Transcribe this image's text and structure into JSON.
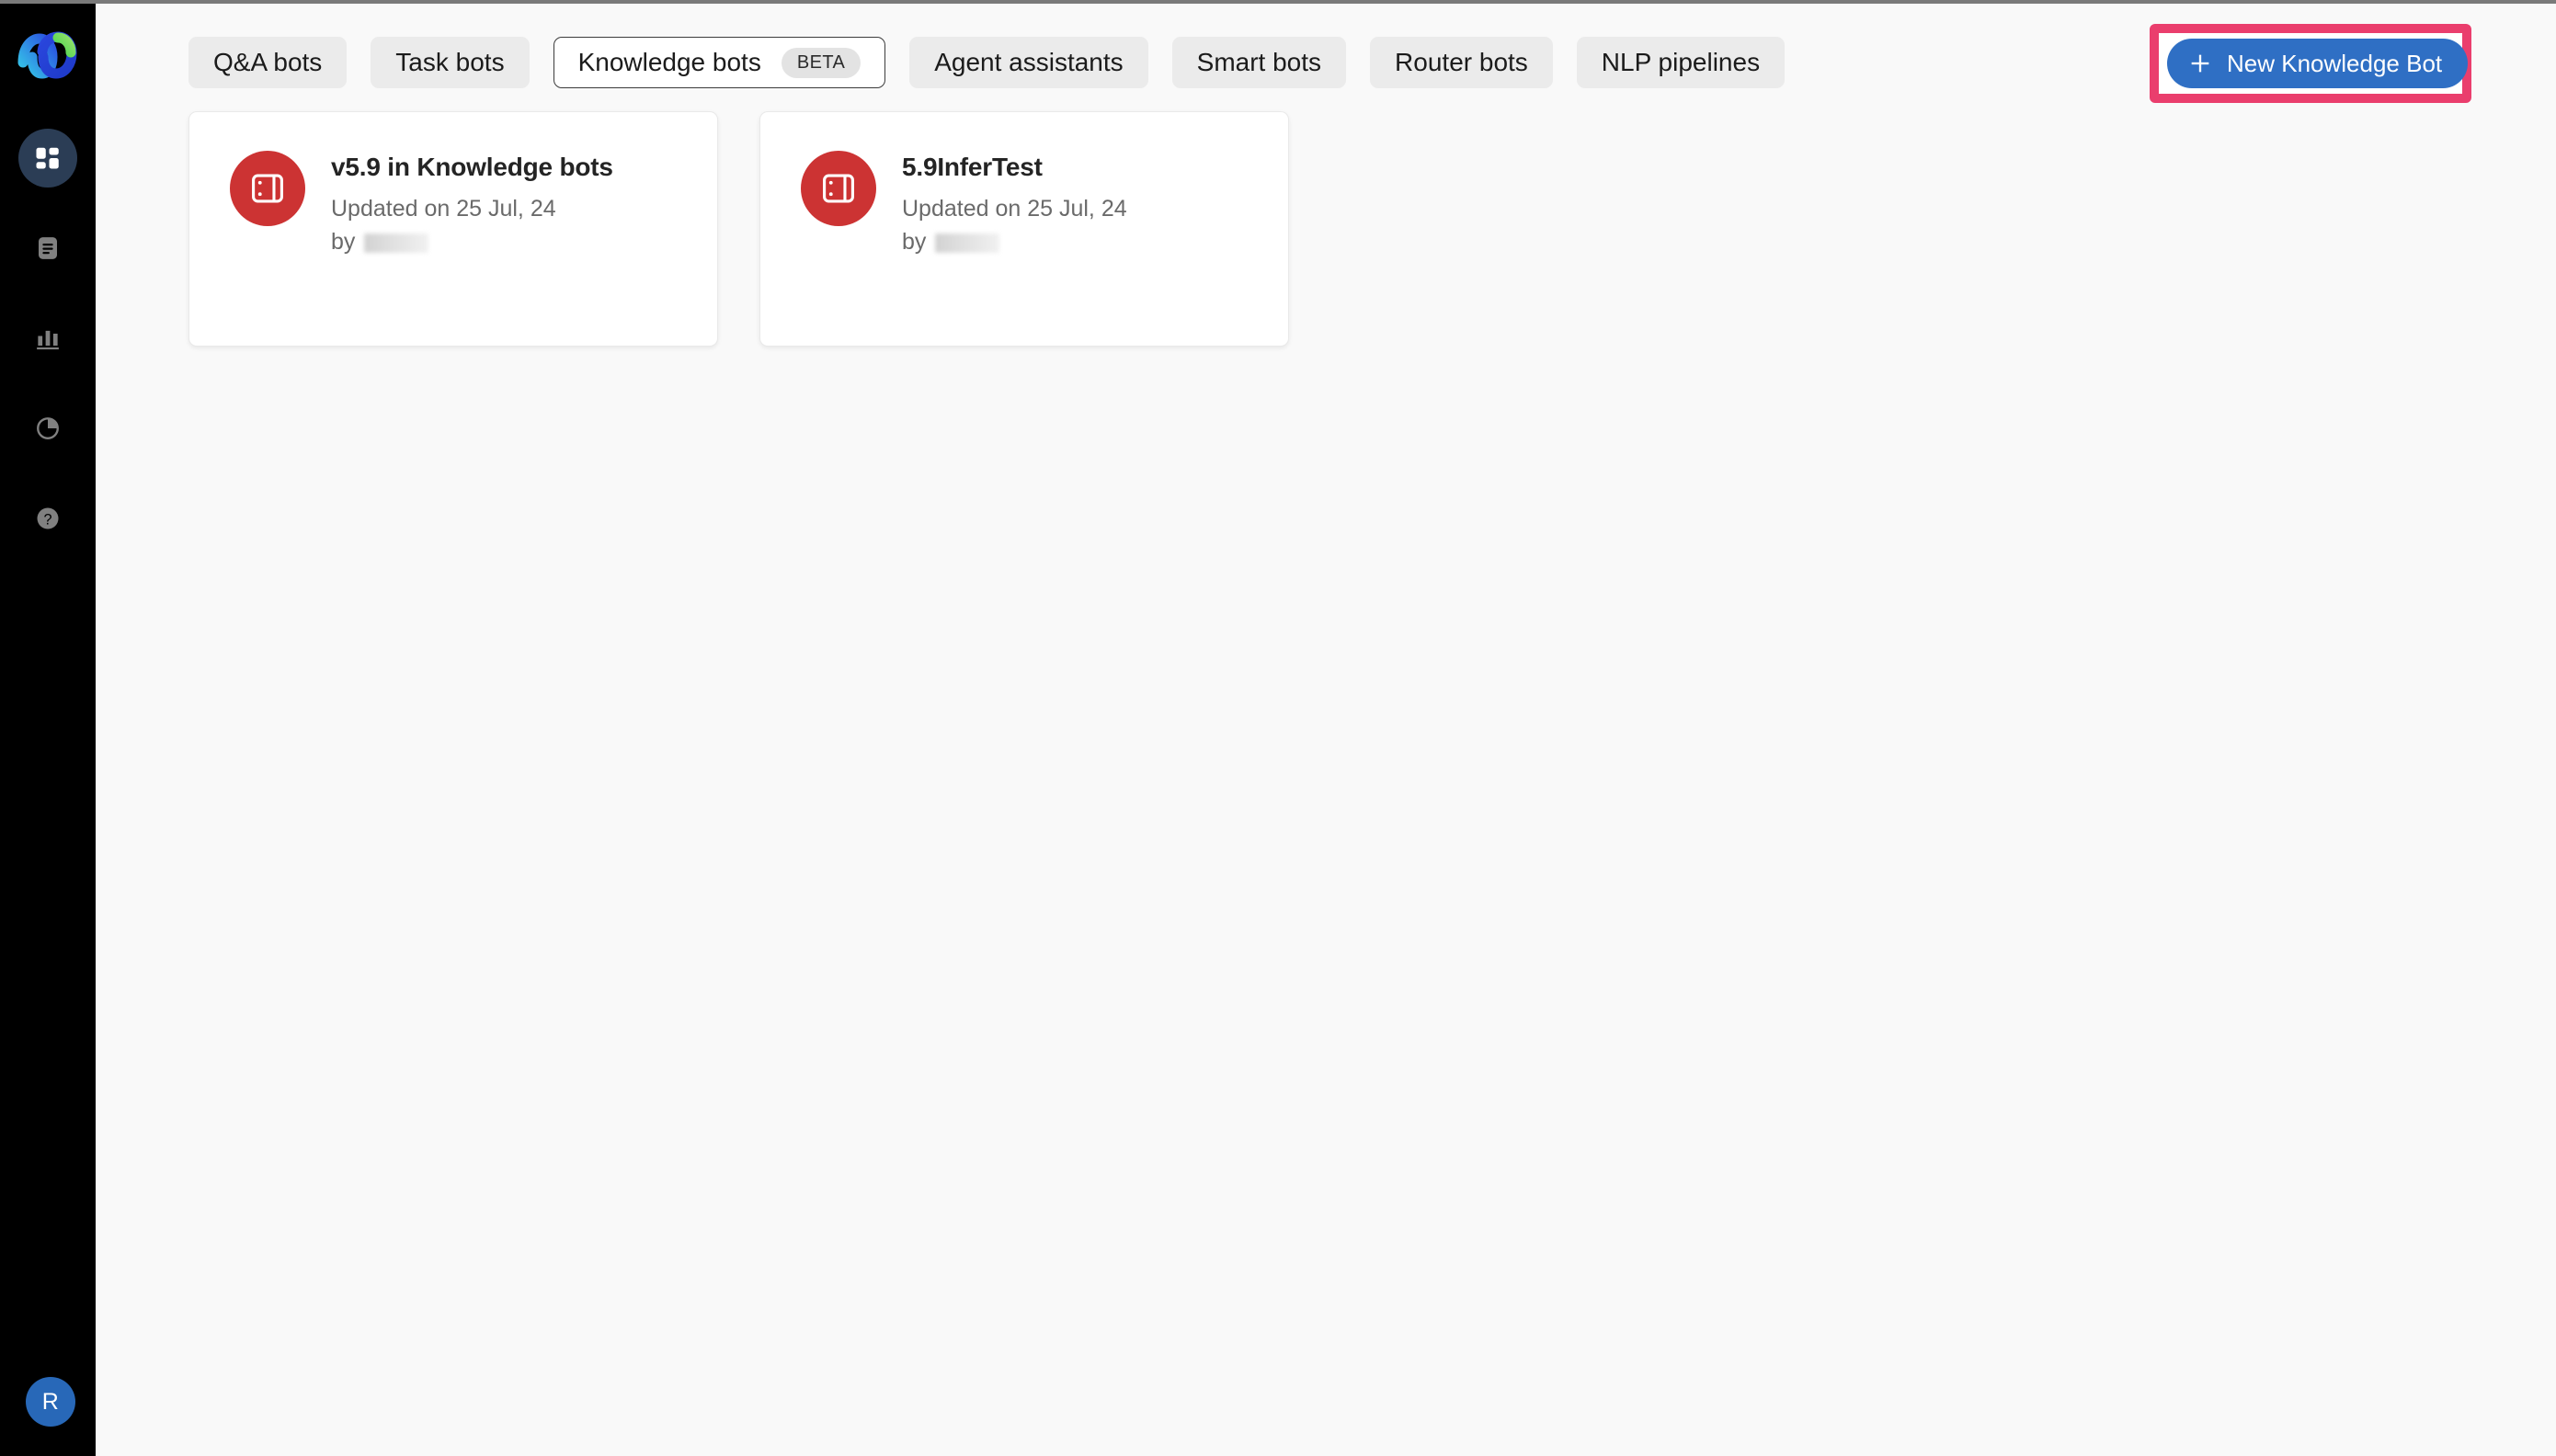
{
  "app": {
    "name": "Webex Connect",
    "logo_icon": "webex-logo"
  },
  "colors": {
    "sidebar_bg": "#000000",
    "page_bg": "#f9f9f9",
    "accent_primary": "#2f6fc4",
    "highlight_outline": "#ea3e6d",
    "bot_avatar_bg": "#cc3333",
    "nav_active_bg": "#2b3d55",
    "user_avatar_bg": "#2868b8"
  },
  "sidebar": {
    "items": [
      {
        "icon": "dashboard-grid-icon",
        "name": "dashboard",
        "active": true
      },
      {
        "icon": "document-icon",
        "name": "documents",
        "active": false
      },
      {
        "icon": "bar-chart-icon",
        "name": "analytics",
        "active": false
      },
      {
        "icon": "pie-chart-icon",
        "name": "reports",
        "active": false
      },
      {
        "icon": "help-question-icon",
        "name": "help",
        "active": false
      }
    ],
    "avatar": {
      "initial": "R",
      "icon": "avatar"
    }
  },
  "topbar": {
    "tabs": [
      {
        "label": "Q&A bots",
        "selected": false,
        "badge": null
      },
      {
        "label": "Task bots",
        "selected": false,
        "badge": null
      },
      {
        "label": "Knowledge bots",
        "selected": true,
        "badge": "BETA"
      },
      {
        "label": "Agent assistants",
        "selected": false,
        "badge": null
      },
      {
        "label": "Smart bots",
        "selected": false,
        "badge": null
      },
      {
        "label": "Router bots",
        "selected": false,
        "badge": null
      },
      {
        "label": "NLP pipelines",
        "selected": false,
        "badge": null
      }
    ],
    "cta": {
      "label": "New Knowledge Bot",
      "icon": "plus-icon",
      "highlighted": true
    }
  },
  "main": {
    "cards": [
      {
        "title": "v5.9 in Knowledge bots",
        "updated": "Updated on 25 Jul, 24",
        "by_label": "by",
        "by_value": "",
        "icon": "knowledge-bot-icon"
      },
      {
        "title": "5.9InferTest",
        "updated": "Updated on 25 Jul, 24",
        "by_label": "by",
        "by_value": "",
        "icon": "knowledge-bot-icon"
      }
    ]
  }
}
